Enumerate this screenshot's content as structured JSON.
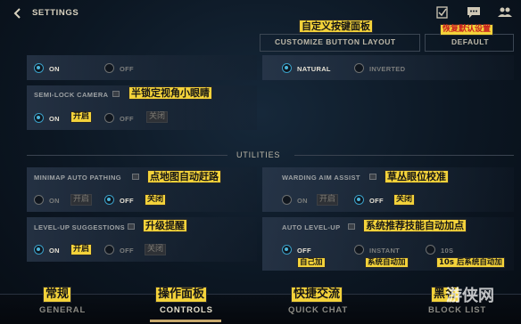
{
  "header": {
    "title": "SETTINGS",
    "customize_label": "CUSTOMIZE BUTTON LAYOUT",
    "default_label": "DEFAULT",
    "customize_cn": "自定义按键面板",
    "default_cn": "恢复默认设置"
  },
  "top_section": {
    "opt_on": "ON",
    "opt_off": "OFF",
    "opt_natural": "NATURAL",
    "opt_inverted": "INVERTED"
  },
  "semi_lock": {
    "label": "SEMI-LOCK CAMERA",
    "cn": "半锁定视角小眼睛",
    "on": "ON",
    "off": "OFF",
    "on_cn": "开启",
    "off_cn": "关闭"
  },
  "utilities": {
    "title": "UTILITIES"
  },
  "minimap": {
    "label": "MINIMAP AUTO PATHING",
    "cn": "点地图自动赶路",
    "on": "ON",
    "off": "OFF",
    "on_cn": "开启",
    "off_cn": "关闭"
  },
  "warding": {
    "label": "WARDING AIM ASSIST",
    "cn": "草丛眼位校准",
    "on": "ON",
    "off": "OFF",
    "on_cn": "开启",
    "off_cn": "关闭"
  },
  "levelup": {
    "label": "LEVEL-UP SUGGESTIONS",
    "cn": "升级提醒",
    "on": "ON",
    "off": "OFF",
    "on_cn": "开启",
    "off_cn": "关闭"
  },
  "autolevel": {
    "label": "AUTO LEVEL-UP",
    "cn": "系统推荐技能自动加点",
    "off": "OFF",
    "instant": "INSTANT",
    "ten_s": "10S",
    "off_cn": "自己加",
    "instant_cn": "系统自动加",
    "ten_s_cn": "10s 后系统自动加"
  },
  "nav": {
    "general": "GENERAL",
    "controls": "CONTROLS",
    "quick_chat": "QUICK CHAT",
    "block_list": "BLOCK LIST",
    "general_cn": "常规",
    "controls_cn": "操作面板",
    "quick_chat_cn": "快捷交流",
    "block_list_cn": "黑名"
  },
  "watermark": "游侠网",
  "colors": {
    "accent_blue": "#4cb6dc",
    "gold": "#c8aa6e",
    "annotation_yellow": "#f3d23a"
  }
}
